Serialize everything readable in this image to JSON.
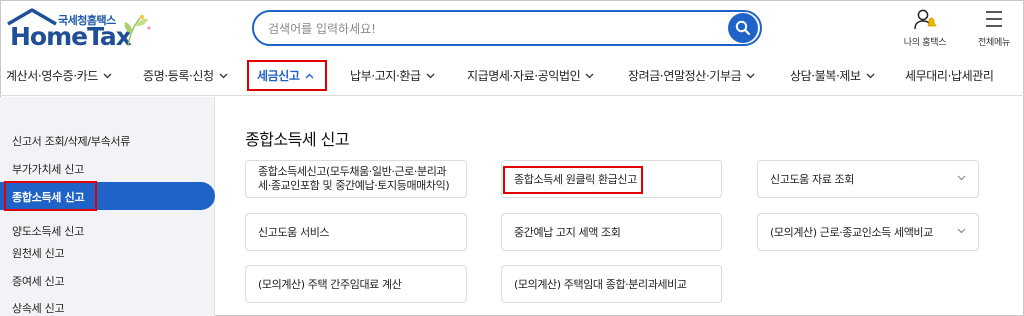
{
  "header": {
    "logo_sub": "국세청홈택스",
    "logo_main": "HomeTax",
    "search_placeholder": "검색어를 입력하세요!",
    "my_hometax_label": "나의 홈택스",
    "all_menu_label": "전체메뉴"
  },
  "nav": {
    "items": [
      {
        "label": "계산서·영수증·카드"
      },
      {
        "label": "증명·등록·신청"
      },
      {
        "label": "세금신고",
        "active": true
      },
      {
        "label": "납부·고지·환급"
      },
      {
        "label": "지급명세·자료·공익법인"
      },
      {
        "label": "장려금·연말정산·기부금"
      },
      {
        "label": "상담·불복·제보"
      },
      {
        "label": "세무대리·납세관리"
      }
    ]
  },
  "sidebar": {
    "items": [
      {
        "label": "신고서 조회/삭제/부속서류"
      },
      {
        "label": "부가가치세 신고"
      },
      {
        "label": "종합소득세 신고",
        "active": true
      },
      {
        "label": "양도소득세 신고"
      },
      {
        "label": "원천세 신고"
      },
      {
        "label": "증여세 신고"
      },
      {
        "label": "상속세 신고"
      }
    ]
  },
  "main": {
    "title": "종합소득세 신고",
    "cards": [
      {
        "line1": "종합소득세신고(모두채움·일반·근로·분리과",
        "line2": "세·종교인포함 및 중간예납·토지등매매차익)",
        "chevron": false
      },
      {
        "line1": "종합소득세 원클릭 환급신고",
        "chevron": false
      },
      {
        "line1": "신고도움 자료 조회",
        "chevron": true
      },
      {
        "line1": "신고도움 서비스",
        "chevron": false
      },
      {
        "line1": "중간예납 고지 세액 조회",
        "chevron": false
      },
      {
        "line1": "(모의계산) 근로·종교인소득 세액비교",
        "chevron": true
      },
      {
        "line1": "(모의계산) 주택 간주임대료 계산",
        "chevron": false
      },
      {
        "line1": "(모의계산) 주택임대 종합·분리과세비교",
        "chevron": false
      }
    ]
  },
  "colors": {
    "accent": "#1f63c9",
    "highlight_box": "#e10000",
    "sidebar_bg": "#f1f3f6"
  }
}
